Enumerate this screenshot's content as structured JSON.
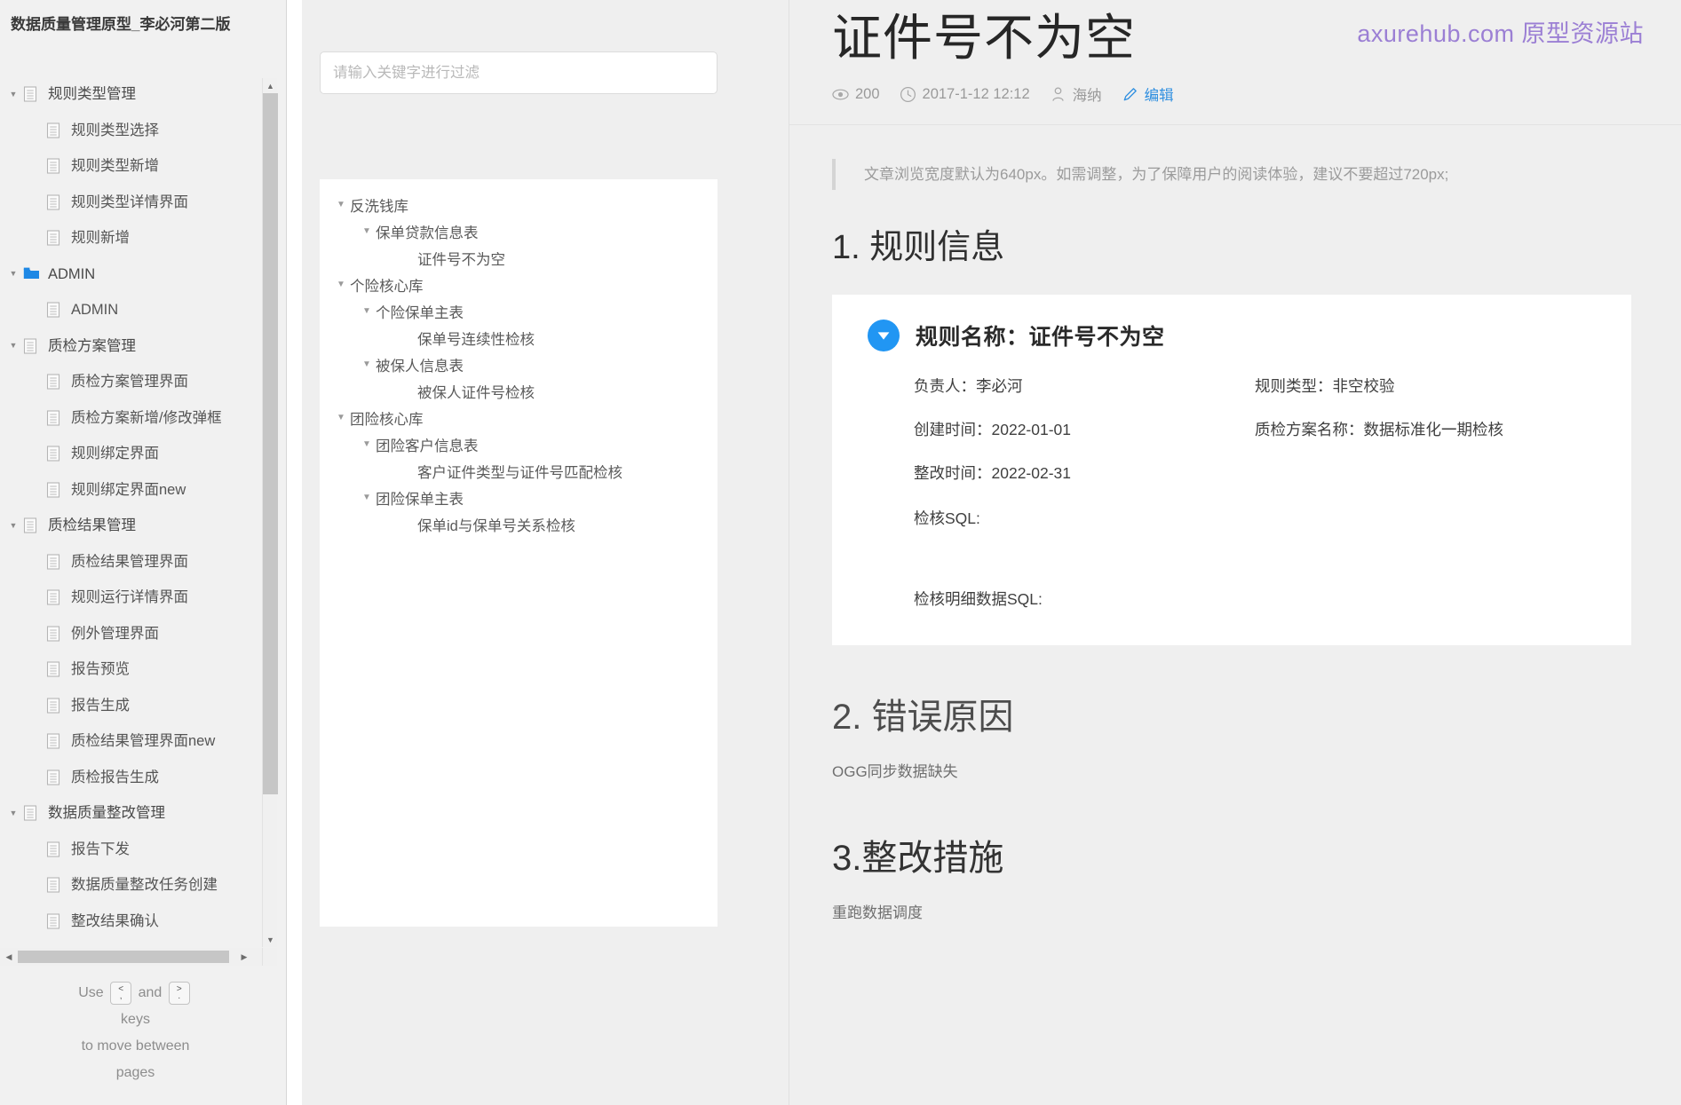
{
  "sidebar": {
    "title": "数据质量管理原型_李必河第二版",
    "tree": [
      {
        "label": "规则类型管理",
        "level": 0,
        "expandable": true,
        "icon": "page-icon"
      },
      {
        "label": "规则类型选择",
        "level": 1,
        "expandable": false,
        "icon": "page-icon"
      },
      {
        "label": "规则类型新增",
        "level": 1,
        "expandable": false,
        "icon": "page-icon"
      },
      {
        "label": "规则类型详情界面",
        "level": 1,
        "expandable": false,
        "icon": "page-icon"
      },
      {
        "label": "规则新增",
        "level": 1,
        "expandable": false,
        "icon": "page-icon"
      },
      {
        "label": "ADMIN",
        "level": 0,
        "expandable": true,
        "icon": "folder-icon"
      },
      {
        "label": "ADMIN",
        "level": 1,
        "expandable": false,
        "icon": "page-icon"
      },
      {
        "label": "质检方案管理",
        "level": 0,
        "expandable": true,
        "icon": "page-icon"
      },
      {
        "label": "质检方案管理界面",
        "level": 1,
        "expandable": false,
        "icon": "page-icon"
      },
      {
        "label": "质检方案新增/修改弹框",
        "level": 1,
        "expandable": false,
        "icon": "page-icon"
      },
      {
        "label": "规则绑定界面",
        "level": 1,
        "expandable": false,
        "icon": "page-icon"
      },
      {
        "label": "规则绑定界面new",
        "level": 1,
        "expandable": false,
        "icon": "page-icon"
      },
      {
        "label": "质检结果管理",
        "level": 0,
        "expandable": true,
        "icon": "page-icon"
      },
      {
        "label": "质检结果管理界面",
        "level": 1,
        "expandable": false,
        "icon": "page-icon"
      },
      {
        "label": "规则运行详情界面",
        "level": 1,
        "expandable": false,
        "icon": "page-icon"
      },
      {
        "label": "例外管理界面",
        "level": 1,
        "expandable": false,
        "icon": "page-icon"
      },
      {
        "label": "报告预览",
        "level": 1,
        "expandable": false,
        "icon": "page-icon"
      },
      {
        "label": "报告生成",
        "level": 1,
        "expandable": false,
        "icon": "page-icon"
      },
      {
        "label": "质检结果管理界面new",
        "level": 1,
        "expandable": false,
        "icon": "page-icon"
      },
      {
        "label": "质检报告生成",
        "level": 1,
        "expandable": false,
        "icon": "page-icon"
      },
      {
        "label": "数据质量整改管理",
        "level": 0,
        "expandable": true,
        "icon": "page-icon"
      },
      {
        "label": "报告下发",
        "level": 1,
        "expandable": false,
        "icon": "page-icon"
      },
      {
        "label": "数据质量整改任务创建",
        "level": 1,
        "expandable": false,
        "icon": "page-icon"
      },
      {
        "label": "整改结果确认",
        "level": 1,
        "expandable": false,
        "icon": "page-icon"
      }
    ],
    "hint": {
      "use": "Use",
      "and": "and",
      "key_prev_top": "<",
      "key_prev_bottom": ",",
      "key_next_top": ">",
      "key_next_bottom": ".",
      "line2": "keys",
      "line3": "to move between",
      "line4": "pages"
    }
  },
  "middle": {
    "filter_placeholder": "请输入关键字进行过滤",
    "filter_value": "",
    "tree": [
      {
        "label": "反洗钱库",
        "level": 0,
        "expandable": true
      },
      {
        "label": "保单贷款信息表",
        "level": 1,
        "expandable": true
      },
      {
        "label": "证件号不为空",
        "level": 2,
        "expandable": false
      },
      {
        "label": "个险核心库",
        "level": 0,
        "expandable": true
      },
      {
        "label": "个险保单主表",
        "level": 1,
        "expandable": true
      },
      {
        "label": "保单号连续性检核",
        "level": 2,
        "expandable": false
      },
      {
        "label": "被保人信息表",
        "level": 1,
        "expandable": true
      },
      {
        "label": "被保人证件号检核",
        "level": 2,
        "expandable": false
      },
      {
        "label": "团险核心库",
        "level": 0,
        "expandable": true
      },
      {
        "label": "团险客户信息表",
        "level": 1,
        "expandable": true
      },
      {
        "label": "客户证件类型与证件号匹配检核",
        "level": 2,
        "expandable": false
      },
      {
        "label": "团险保单主表",
        "level": 1,
        "expandable": true
      },
      {
        "label": "保单id与保单号关系检核",
        "level": 2,
        "expandable": false
      }
    ]
  },
  "document": {
    "title": "证件号不为空",
    "watermark": "axurehub.com 原型资源站",
    "meta": {
      "views": "200",
      "date": "2017-1-12 12:12",
      "author": "海纳",
      "edit_label": "编辑"
    },
    "tip": "文章浏览宽度默认为640px。如需调整，为了保障用户的阅读体验，建议不要超过720px;",
    "section1": {
      "heading": "1. 规则信息",
      "card": {
        "rule_name_label": "规则名称：",
        "rule_name_value": "证件号不为空",
        "fields": [
          {
            "label": "负责人：",
            "value": "李必河"
          },
          {
            "label": "规则类型：",
            "value": "非空校验"
          },
          {
            "label": "创建时间：",
            "value": "2022-01-01"
          },
          {
            "label": "质检方案名称：",
            "value": "数据标准化一期检核"
          },
          {
            "label": "整改时间：",
            "value": "2022-02-31"
          }
        ],
        "sql_label": "检核SQL:",
        "sql_value": "",
        "detail_sql_label": "检核明细数据SQL:",
        "detail_sql_value": ""
      }
    },
    "section2": {
      "heading": "2. 错误原因",
      "body": "OGG同步数据缺失"
    },
    "section3": {
      "heading": "3.整改措施",
      "body": "重跑数据调度"
    }
  },
  "colors": {
    "accent_blue": "#2196f3",
    "link_blue": "#2f8fe0",
    "watermark_purple": "#9b7fd4",
    "page_bg": "#efefef",
    "card_bg": "#ffffff"
  }
}
